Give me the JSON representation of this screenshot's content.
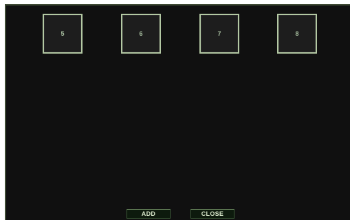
{
  "slots": [
    {
      "label": "5"
    },
    {
      "label": "6"
    },
    {
      "label": "7"
    },
    {
      "label": "8"
    }
  ],
  "buttons": {
    "add_label": "ADD",
    "close_label": "CLOSE"
  },
  "colors": {
    "background": "#101010",
    "slot_border": "#b3c8a3",
    "slot_text": "#a8bfa0",
    "button_bg": "#0d1a0d",
    "button_text": "#d6e5c8"
  }
}
